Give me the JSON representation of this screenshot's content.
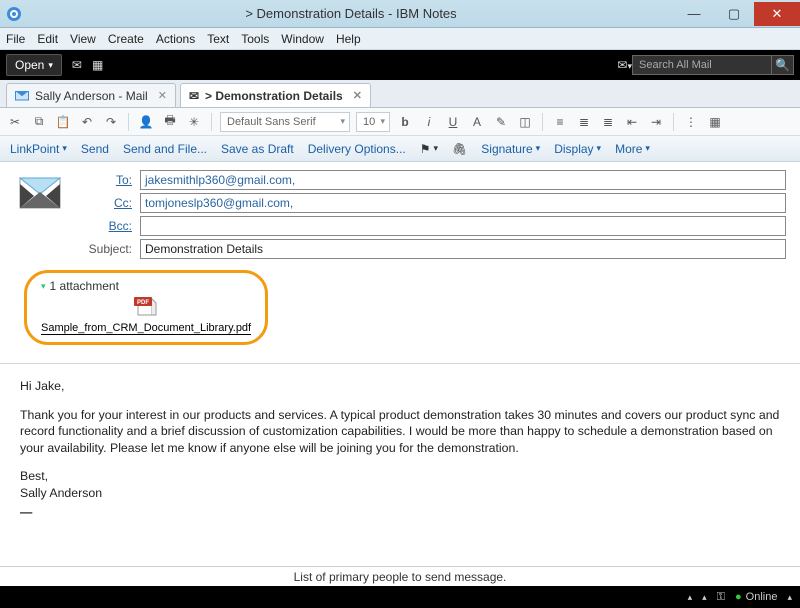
{
  "window": {
    "title": "> Demonstration Details - IBM Notes"
  },
  "menu": [
    "File",
    "Edit",
    "View",
    "Create",
    "Actions",
    "Text",
    "Tools",
    "Window",
    "Help"
  ],
  "blackbar": {
    "open": "Open",
    "search_placeholder": "Search All Mail"
  },
  "tabs": [
    {
      "label": "Sally Anderson - Mail",
      "active": false
    },
    {
      "label": "> Demonstration Details",
      "active": true
    }
  ],
  "format": {
    "font": "Default Sans Serif",
    "size": "10"
  },
  "actions": {
    "linkpoint": "LinkPoint",
    "send": "Send",
    "sendfile": "Send and File...",
    "savedraft": "Save as Draft",
    "delivery": "Delivery Options...",
    "signature": "Signature",
    "display": "Display",
    "more": "More"
  },
  "fields": {
    "to_label": "To:",
    "to_value": "jakesmithlp360@gmail.com,",
    "cc_label": "Cc:",
    "cc_value": "tomjoneslp360@gmail.com,",
    "bcc_label": "Bcc:",
    "bcc_value": "",
    "subject_label": "Subject:",
    "subject_value": "Demonstration Details"
  },
  "attachment": {
    "count_label": "1 attachment",
    "filename": "Sample_from_CRM_Document_Library.pdf"
  },
  "body": {
    "greeting": "Hi Jake,",
    "para": "Thank you for your interest in our products and services. A typical product demonstration takes 30 minutes and covers our product sync and record functionality and a brief discussion of customization capabilities. I would be more than happy to schedule a demonstration based on your availability. Please let me know if anyone else will be joining you for the demonstration.",
    "closing": "Best,",
    "signature": "Sally Anderson"
  },
  "info": "List of primary people to send message.",
  "status": {
    "online": "Online"
  }
}
